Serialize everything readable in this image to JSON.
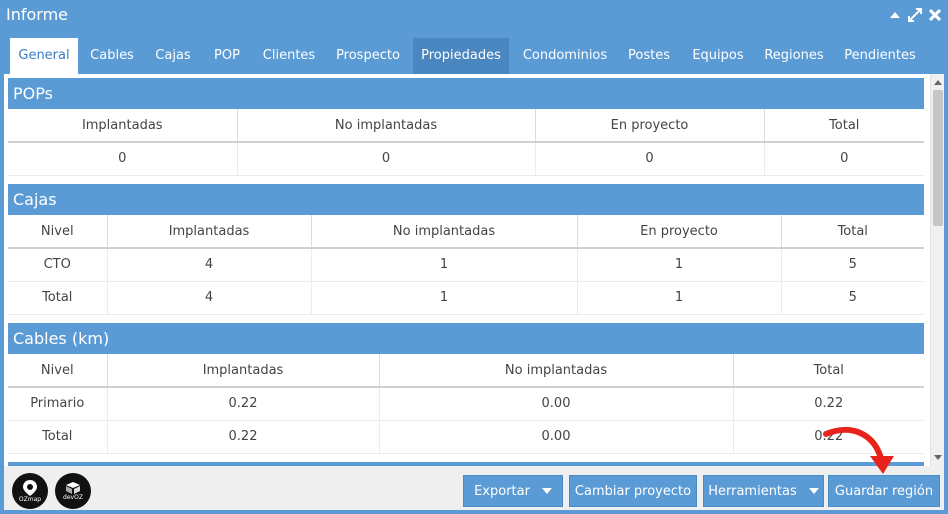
{
  "window": {
    "title": "Informe"
  },
  "tabs": [
    {
      "label": "General",
      "active": true
    },
    {
      "label": "Cables"
    },
    {
      "label": "Cajas"
    },
    {
      "label": "POP"
    },
    {
      "label": "Clientes"
    },
    {
      "label": "Prospecto"
    },
    {
      "label": "Propiedades",
      "hover": true
    },
    {
      "label": "Condominios"
    },
    {
      "label": "Postes"
    },
    {
      "label": "Equipos"
    },
    {
      "label": "Regiones"
    },
    {
      "label": "Pendientes"
    }
  ],
  "sections": {
    "pops": {
      "title": "POPs",
      "headers": [
        "Implantadas",
        "No implantadas",
        "En proyecto",
        "Total"
      ],
      "rows": [
        [
          "0",
          "0",
          "0",
          "0"
        ]
      ]
    },
    "cajas": {
      "title": "Cajas",
      "headers": [
        "Nivel",
        "Implantadas",
        "No implantadas",
        "En proyecto",
        "Total"
      ],
      "rows": [
        [
          "CTO",
          "4",
          "1",
          "1",
          "5"
        ],
        [
          "Total",
          "4",
          "1",
          "1",
          "5"
        ]
      ]
    },
    "cables": {
      "title": "Cables (km)",
      "headers": [
        "Nivel",
        "Implantadas",
        "No implantadas",
        "Total"
      ],
      "rows": [
        [
          "Primario",
          "0.22",
          "0.00",
          "0.22"
        ],
        [
          "Total",
          "0.22",
          "0.00",
          "0.22"
        ]
      ]
    }
  },
  "footer": {
    "logos": [
      {
        "name": "OZmap",
        "icon": "ozmap-logo"
      },
      {
        "name": "devOZ",
        "icon": "devoz-logo"
      }
    ],
    "buttons": {
      "exportar": "Exportar",
      "cambiar_proyecto": "Cambiar proyecto",
      "herramientas": "Herramientas",
      "guardar_region": "Guardar región"
    }
  },
  "colors": {
    "accent": "#5b9bd5",
    "annotation_arrow": "#e8231b"
  }
}
